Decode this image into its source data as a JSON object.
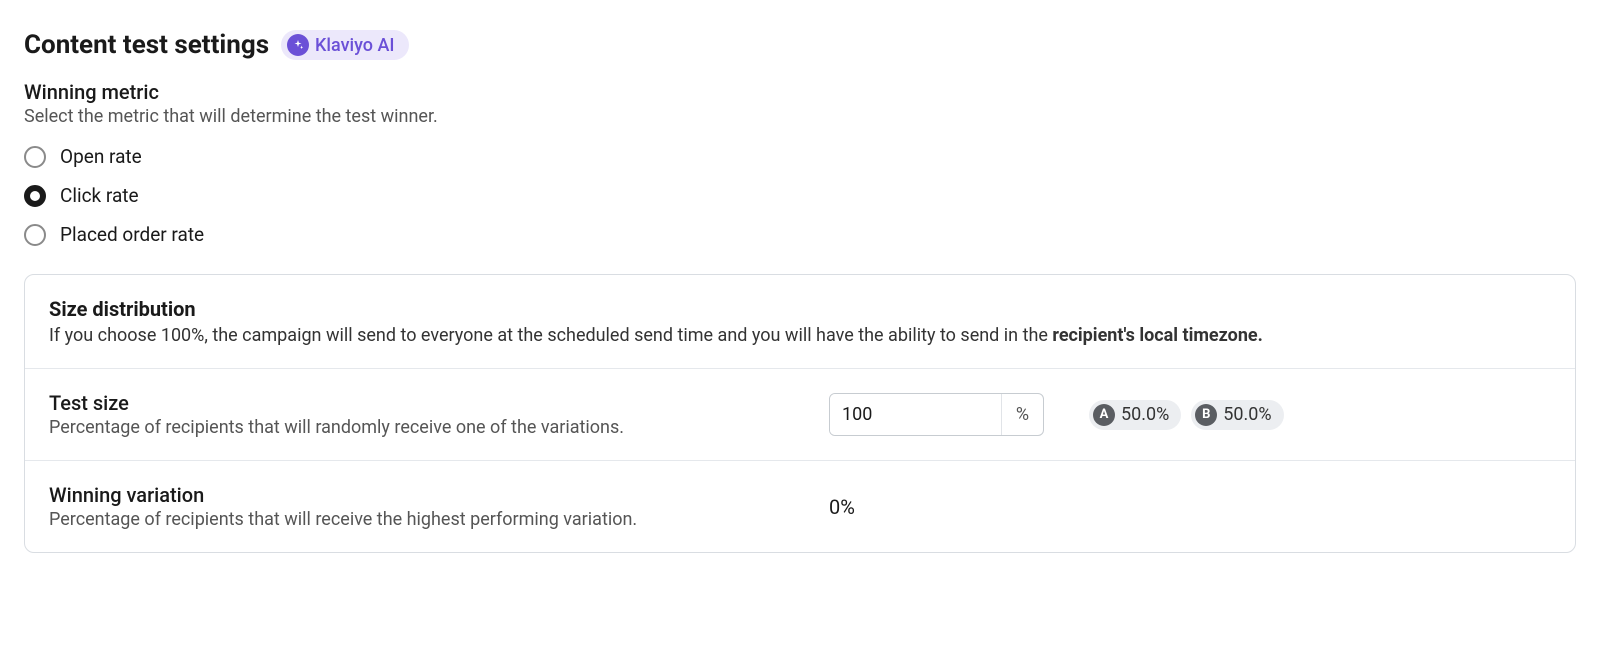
{
  "header": {
    "title": "Content test settings",
    "ai_badge": "Klaviyo AI"
  },
  "winning_metric": {
    "label": "Winning metric",
    "description": "Select the metric that will determine the test winner.",
    "options": [
      {
        "label": "Open rate",
        "selected": false
      },
      {
        "label": "Click rate",
        "selected": true
      },
      {
        "label": "Placed order rate",
        "selected": false
      }
    ]
  },
  "size_distribution": {
    "title": "Size distribution",
    "description_prefix": "If you choose 100%, the campaign will send to everyone at the scheduled send time and you will have the ability to send in the ",
    "description_bold": "recipient's local timezone."
  },
  "test_size": {
    "label": "Test size",
    "description": "Percentage of recipients that will randomly receive one of the variations.",
    "value": "100",
    "suffix": "%",
    "variants": [
      {
        "letter": "A",
        "percent": "50.0%"
      },
      {
        "letter": "B",
        "percent": "50.0%"
      }
    ]
  },
  "winning_variation": {
    "label": "Winning variation",
    "description": "Percentage of recipients that will receive the highest performing variation.",
    "value": "0%"
  }
}
